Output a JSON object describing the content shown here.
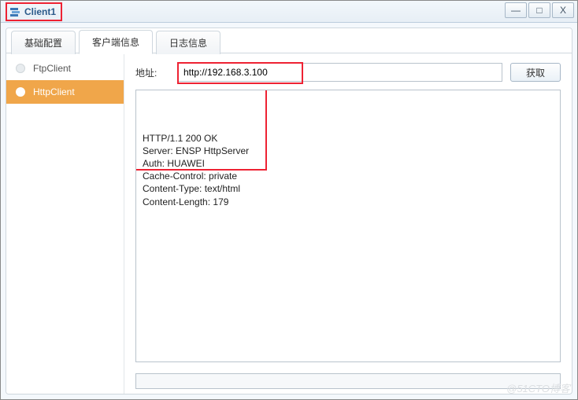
{
  "window": {
    "title": "Client1",
    "controls": {
      "minimize": "—",
      "maximize": "□",
      "close": "X"
    }
  },
  "tabs": [
    {
      "id": "basic",
      "label": "基础配置",
      "active": false
    },
    {
      "id": "client",
      "label": "客户端信息",
      "active": true
    },
    {
      "id": "log",
      "label": "日志信息",
      "active": false
    }
  ],
  "sidebar": {
    "items": [
      {
        "id": "ftp",
        "label": "FtpClient",
        "active": false
      },
      {
        "id": "http",
        "label": "HttpClient",
        "active": true
      }
    ]
  },
  "main": {
    "address_label": "地址:",
    "address_value": "http://192.168.3.100",
    "fetch_button": "获取",
    "response_lines": [
      "HTTP/1.1 200 OK",
      "Server: ENSP HttpServer",
      "Auth: HUAWEI",
      "Cache-Control: private",
      "Content-Type: text/html",
      "Content-Length: 179"
    ]
  },
  "watermark": "@51CTO博客",
  "highlight_color": "#ee2233"
}
